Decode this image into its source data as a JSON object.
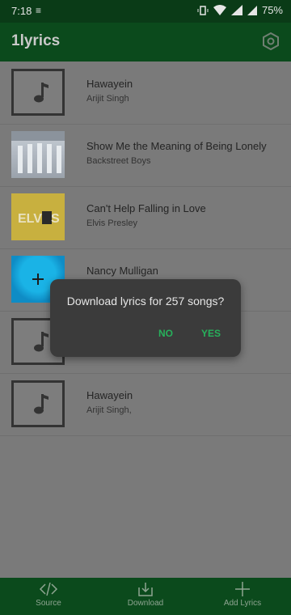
{
  "status": {
    "time": "7:18",
    "battery": "75%"
  },
  "app": {
    "title": "1lyrics"
  },
  "songs": [
    {
      "title": "Hawayein",
      "artist": "Arijit Singh",
      "thumb": "note-icon"
    },
    {
      "title": "Show Me the Meaning of Being Lonely",
      "artist": "Backstreet Boys",
      "thumb": "album-cover"
    },
    {
      "title": "Can't Help Falling in Love",
      "artist": "Elvis Presley",
      "thumb": "album-cover"
    },
    {
      "title": "Nancy Mulligan",
      "artist": "",
      "thumb": "album-cover"
    },
    {
      "title": "",
      "artist": "",
      "thumb": "note-icon"
    },
    {
      "title": "Hawayein",
      "artist": "Arijit Singh,",
      "thumb": "note-icon"
    }
  ],
  "dialog": {
    "message": "Download lyrics for 257 songs?",
    "no_label": "NO",
    "yes_label": "YES"
  },
  "bottom_nav": {
    "source_label": "Source",
    "download_label": "Download",
    "add_label": "Add Lyrics"
  },
  "colors": {
    "accent": "#27b05b",
    "appbar": "#0b4a1c"
  }
}
